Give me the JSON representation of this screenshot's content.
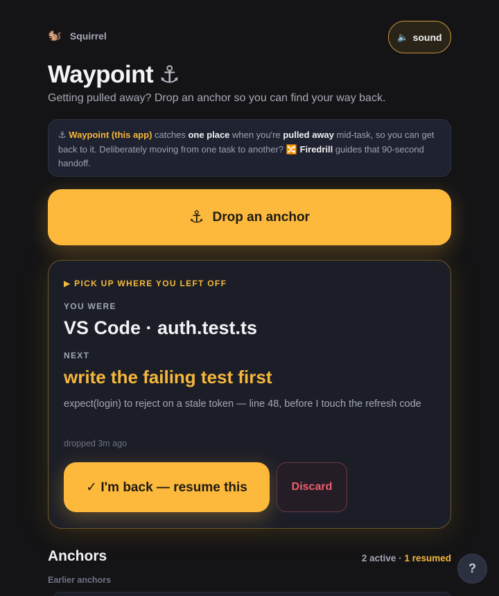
{
  "header": {
    "brand_icon": "🐿️",
    "brand_name": "Squirrel",
    "sound_icon": "🔈",
    "sound_label": "sound"
  },
  "title": {
    "text": "Waypoint",
    "icon": "⚓",
    "subtitle": "Getting pulled away? Drop an anchor so you can find your way back."
  },
  "info": {
    "icon": "⚓",
    "app_name": "Waypoint (this app)",
    "t1": " catches ",
    "b1": "one place",
    "t2": " when you're ",
    "b2": "pulled away",
    "t3": " mid-task, so you can get back to it. Deliberately moving from one task to another? ",
    "firedrill_icon": "🔀",
    "b3": "Firedrill",
    "t4": " guides that 90-second handoff."
  },
  "drop": {
    "icon": "⚓",
    "label": "Drop an anchor"
  },
  "pickup": {
    "heading": "▶ PICK UP WHERE YOU LEFT OFF",
    "were_label": "YOU WERE",
    "were_value": "VS Code · auth.test.ts",
    "next_label": "NEXT",
    "next_value": "write the failing test first",
    "note": "expect(login) to reject on a stale token — line 48, before I touch the refresh code",
    "dropped": "dropped 3m ago",
    "resume_label": "✓ I'm back — resume this",
    "discard_label": "Discard"
  },
  "anchors": {
    "heading": "Anchors",
    "active": "2 active",
    "sep": " · ",
    "resumed": "1 resumed",
    "earlier_label": "Earlier anchors"
  },
  "help": {
    "label": "?"
  },
  "colors": {
    "accent": "#fdb93c",
    "background": "#141416",
    "danger": "#ef5d6c"
  }
}
